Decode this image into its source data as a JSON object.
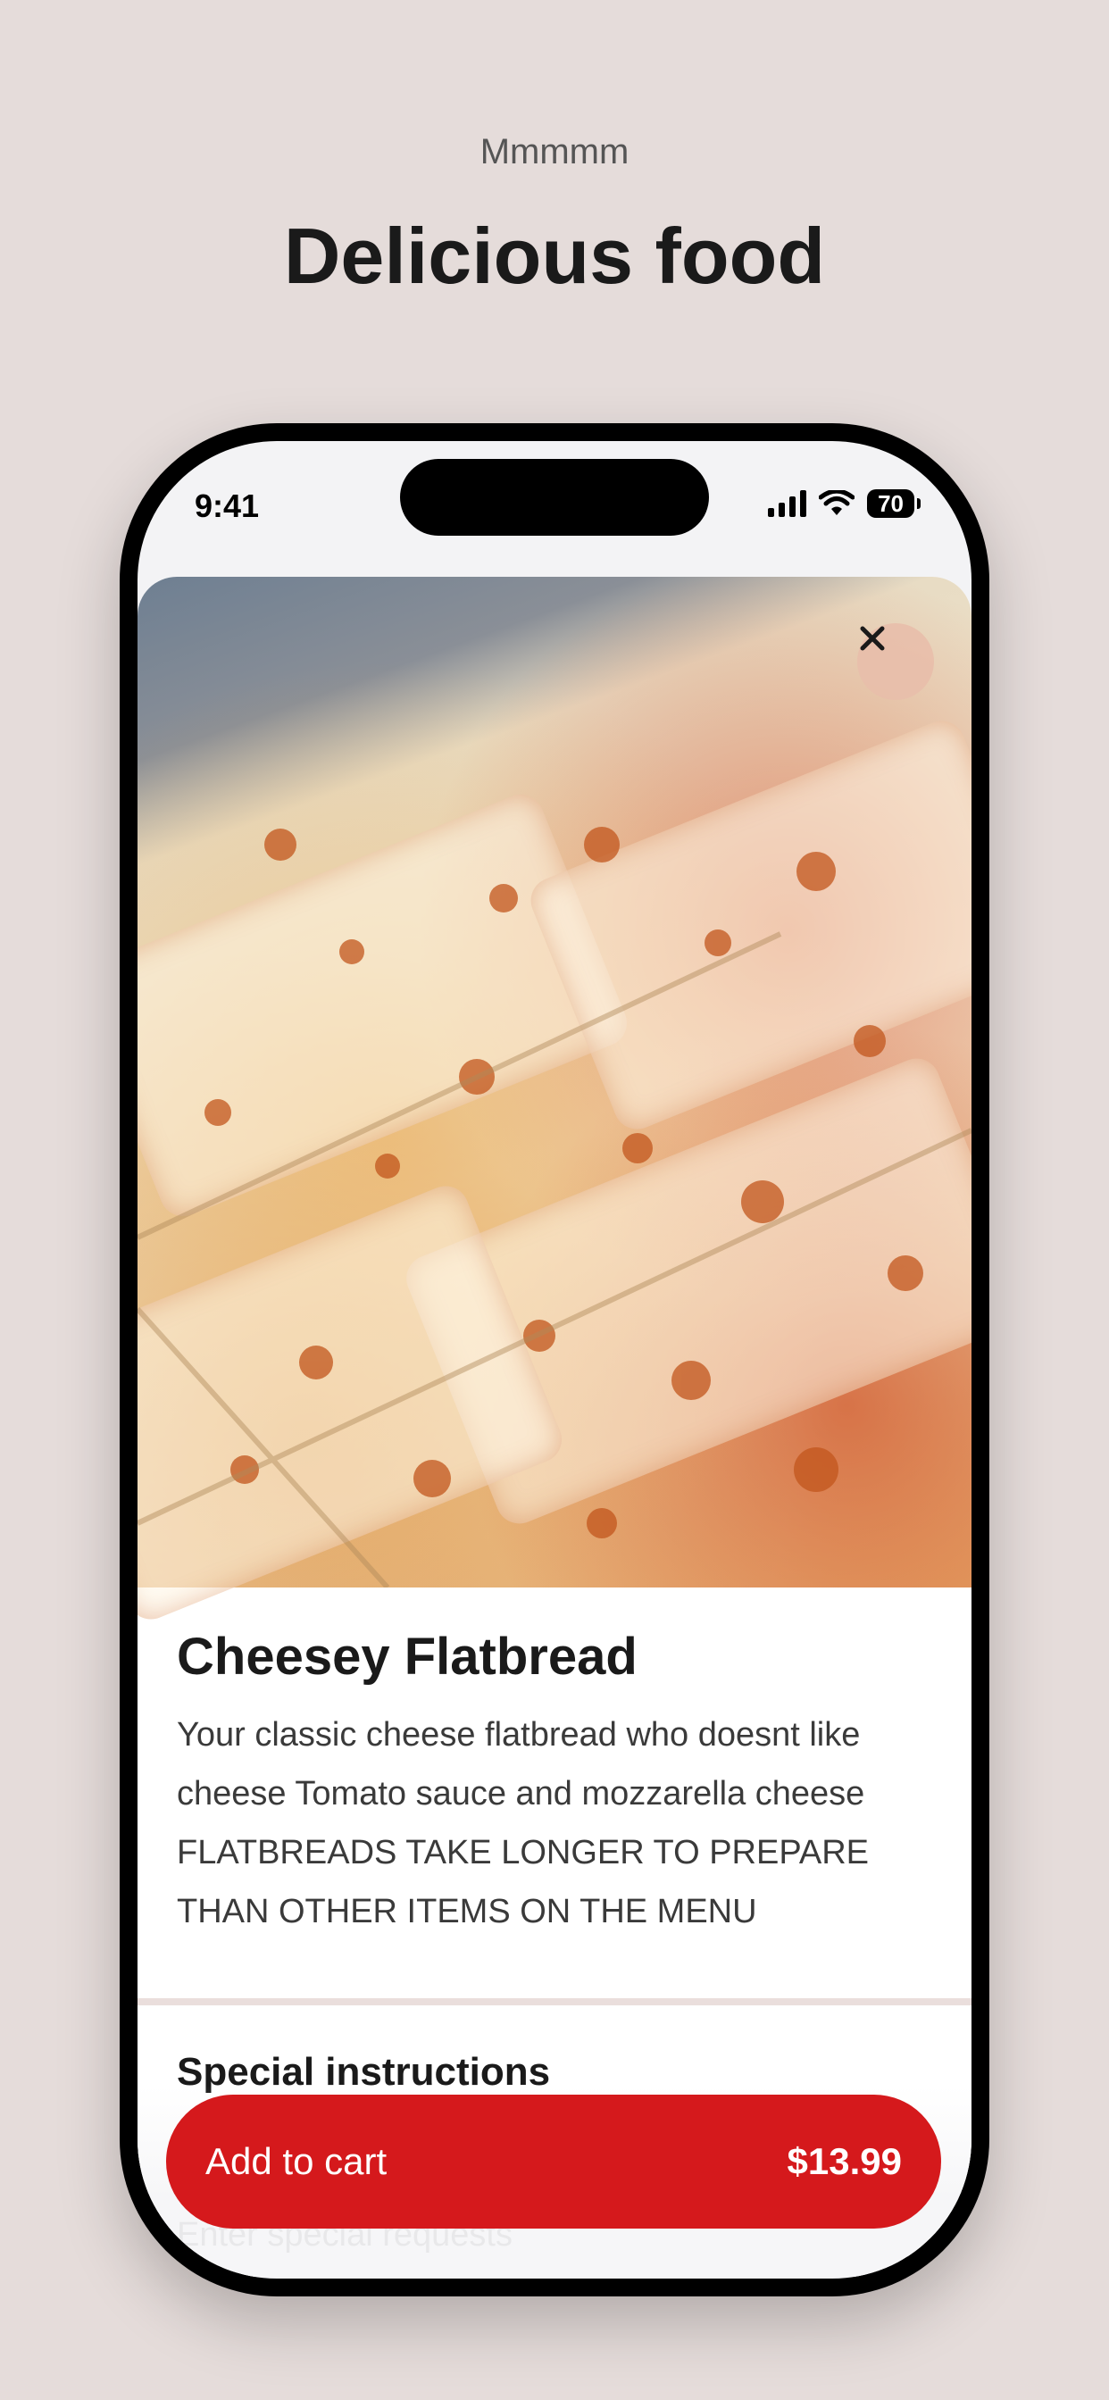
{
  "header": {
    "kicker": "Mmmmm",
    "headline": "Delicious food"
  },
  "status_bar": {
    "time": "9:41",
    "battery": "70",
    "icons": [
      "signal-icon",
      "wifi-icon",
      "battery-icon"
    ]
  },
  "item": {
    "photo_subject": "cheese flatbread",
    "close_icon": "close-icon",
    "title": "Cheesey Flatbread",
    "description": "Your classic cheese flatbread who doesnt like cheese Tomato sauce and mozzarella cheese FLATBREADS TAKE LONGER TO PREPARE THAN OTHER ITEMS ON THE MENU"
  },
  "special_instructions": {
    "title": "Special instructions",
    "placeholder": "Enter special requests"
  },
  "cart_button": {
    "label": "Add to cart",
    "price": "$13.99",
    "color": "#d5191c"
  }
}
